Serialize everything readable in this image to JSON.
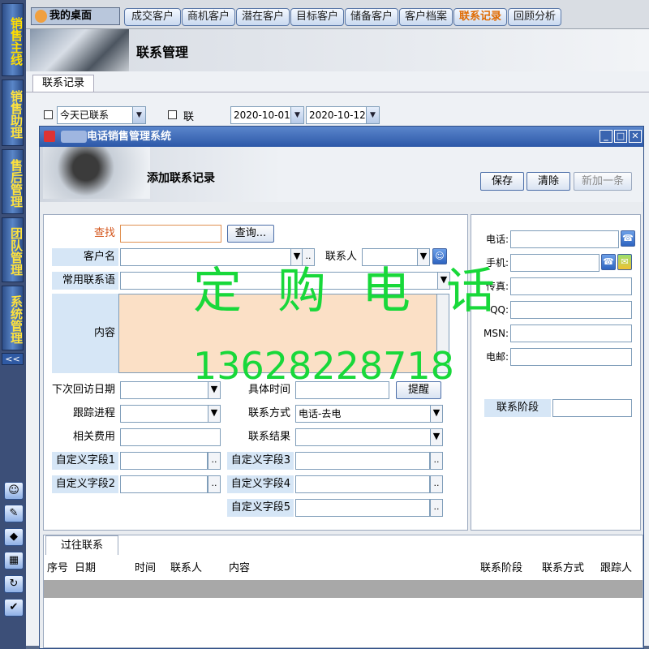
{
  "sidebar": {
    "items": [
      {
        "label": "销售主线"
      },
      {
        "label": "销售助理"
      },
      {
        "label": "售后管理"
      },
      {
        "label": "团队管理"
      },
      {
        "label": "系统管理"
      }
    ],
    "collapse_label": "<<",
    "icons": [
      "user-icon",
      "edit-icon",
      "compass-icon",
      "calendar-icon",
      "sync-icon",
      "shield-icon"
    ]
  },
  "topbar": {
    "home_label": "我的桌面",
    "tabs": [
      "成交客户",
      "商机客户",
      "潜在客户",
      "目标客户",
      "储备客户",
      "客户档案",
      "联系记录",
      "回顾分析"
    ]
  },
  "main": {
    "title": "联系管理",
    "tab": "联系记录",
    "filter": {
      "today_value": "今天已联系",
      "date_label": "联系日期",
      "date_from": "2020-10-01",
      "date_to": "2020-10-12"
    }
  },
  "dialog": {
    "title": "电话销售管理系统",
    "heading": "添加联系记录",
    "buttons": {
      "save": "保存",
      "clear": "清除",
      "add_new": "新加一条"
    },
    "form": {
      "find_label": "查找",
      "find_value": "",
      "query_button": "查询...",
      "customer_label": "客户名",
      "customer_value": "",
      "contact_label": "联系人",
      "contact_value": "",
      "common_phrase_label": "常用联系语",
      "content_label": "内容",
      "content_value": "",
      "next_visit_label": "下次回访日期",
      "specific_time_label": "具体时间",
      "remind_button": "提醒",
      "progress_label": "跟踪进程",
      "method_label": "联系方式",
      "method_value": "电话-去电",
      "cost_label": "相关费用",
      "result_label": "联系结果",
      "custom1_label": "自定义字段1",
      "custom2_label": "自定义字段2",
      "custom3_label": "自定义字段3",
      "custom4_label": "自定义字段4",
      "custom5_label": "自定义字段5",
      "dots": ".."
    },
    "right": {
      "phone_label": "电话:",
      "mobile_label": "手机:",
      "fax_label": "传真:",
      "qq_label": "QQ:",
      "msn_label": "MSN:",
      "email_label": "电邮:",
      "stage_label": "联系阶段"
    },
    "history": {
      "tab": "过往联系",
      "columns": [
        "序号",
        "日期",
        "时间",
        "联系人",
        "内容",
        "联系阶段",
        "联系方式",
        "跟踪人"
      ]
    }
  },
  "watermark": {
    "line1": "定购电话",
    "line2": "13628228718"
  },
  "colors": {
    "accent": "#2c58a8",
    "watermark": "#18d83a",
    "content_bg": "#fbe0c6",
    "label_bg": "#d6e6f6"
  }
}
